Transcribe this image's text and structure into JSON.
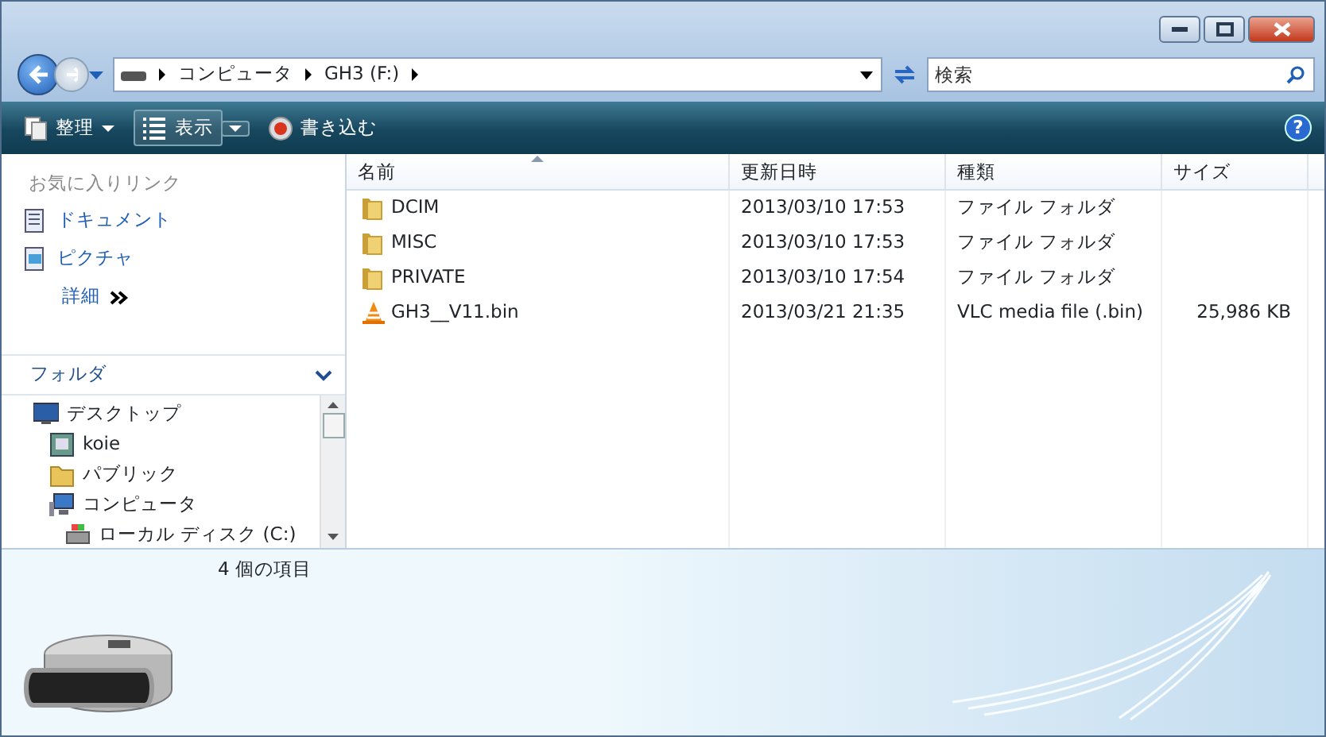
{
  "address": {
    "path": [
      "コンピュータ",
      "GH3 (F:)"
    ]
  },
  "search": {
    "placeholder": "検索"
  },
  "help": {
    "label": "?"
  },
  "toolbar": [
    {
      "label": "整理",
      "kind": "menu"
    },
    {
      "label": "表示",
      "kind": "split"
    },
    {
      "label": "書き込む",
      "kind": "burn"
    }
  ],
  "favorites": {
    "title": "お気に入りリンク",
    "items": [
      {
        "label": "ドキュメント",
        "kind": "documents"
      },
      {
        "label": "ピクチャ",
        "kind": "pictures"
      }
    ],
    "more": "詳細"
  },
  "folders": {
    "title": "フォルダ",
    "tree": [
      {
        "label": "デスクトップ",
        "kind": "desktop",
        "children": [
          {
            "label": "koie",
            "kind": "user"
          },
          {
            "label": "パブリック",
            "kind": "folder"
          },
          {
            "label": "コンピュータ",
            "kind": "computer",
            "children": [
              {
                "label": "ローカル ディスク (C:)",
                "kind": "disk"
              }
            ]
          }
        ]
      }
    ]
  },
  "table": {
    "columns": [
      {
        "label": "名前",
        "sorted": true
      },
      {
        "label": "更新日時",
        "sorted": false
      },
      {
        "label": "種類",
        "sorted": false
      },
      {
        "label": "サイズ",
        "sorted": false
      }
    ],
    "rows": [
      {
        "kind": "folder",
        "cells": [
          "DCIM",
          "2013/03/10 17:53",
          "ファイル フォルダ",
          ""
        ]
      },
      {
        "kind": "folder",
        "cells": [
          "MISC",
          "2013/03/10 17:53",
          "ファイル フォルダ",
          ""
        ]
      },
      {
        "kind": "folder",
        "cells": [
          "PRIVATE",
          "2013/03/10 17:54",
          "ファイル フォルダ",
          ""
        ]
      },
      {
        "kind": "vlc",
        "cells": [
          "GH3__V11.bin",
          "2013/03/21 21:35",
          "VLC media file (.bin)",
          "25,986 KB"
        ]
      }
    ]
  },
  "status_bar": {
    "count": "4 個の項目"
  }
}
